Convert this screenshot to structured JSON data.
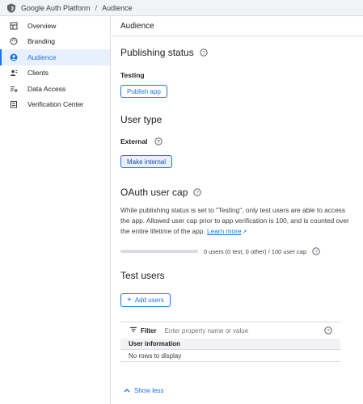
{
  "breadcrumb": {
    "app": "Google Auth Platform",
    "separator": "/",
    "current": "Audience"
  },
  "sidebar": {
    "items": [
      {
        "label": "Overview",
        "icon": "grid-icon"
      },
      {
        "label": "Branding",
        "icon": "palette-icon"
      },
      {
        "label": "Audience",
        "icon": "person-circle-icon",
        "active": true
      },
      {
        "label": "Clients",
        "icon": "person-badge-icon"
      },
      {
        "label": "Data Access",
        "icon": "list-key-icon"
      },
      {
        "label": "Verification Center",
        "icon": "checklist-icon"
      }
    ]
  },
  "main": {
    "header": "Audience",
    "publishing": {
      "title": "Publishing status",
      "status": "Testing",
      "button": "Publish app"
    },
    "user_type": {
      "title": "User type",
      "value": "External",
      "button": "Make internal"
    },
    "oauth": {
      "title": "OAuth user cap",
      "paragraph": "While publishing status is set to \"Testing\", only test users are able to access the app. Allowed user cap prior to app verification is 100, and is counted over the entire lifetime of the app.",
      "link": "Learn more",
      "cap_text": "0 users (0 test, 0 other) / 100 user cap",
      "cap_fraction": 0
    },
    "test_users": {
      "title": "Test users",
      "add_button": "Add users",
      "filter_label": "Filter",
      "filter_placeholder": "Enter property name or value",
      "column": "User information",
      "empty": "No rows to display",
      "show_less": "Show less"
    }
  },
  "colors": {
    "accent": "#1a73e8",
    "active_bg": "#e8f0fe",
    "border": "#dadce0"
  }
}
